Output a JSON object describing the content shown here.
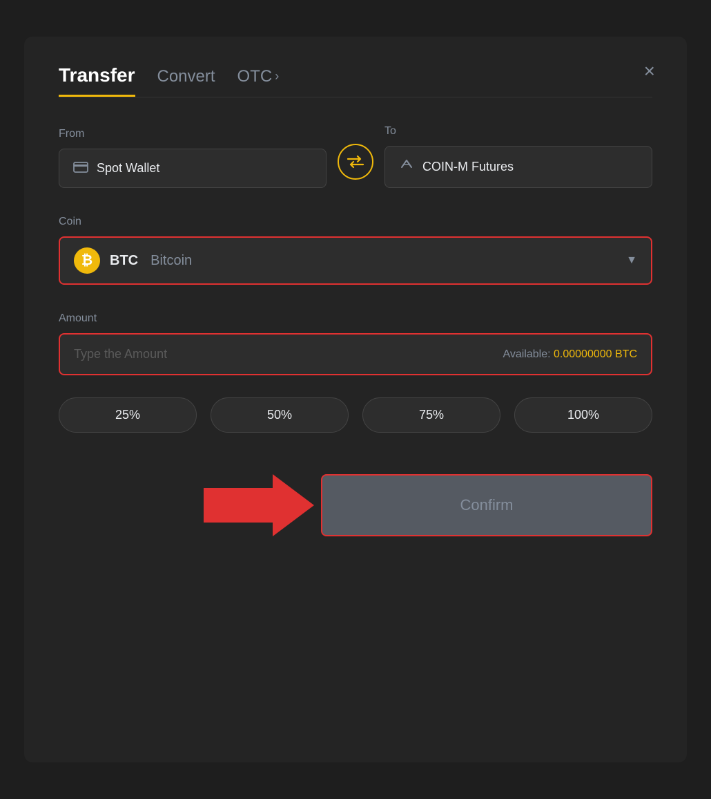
{
  "header": {
    "tab_transfer": "Transfer",
    "tab_convert": "Convert",
    "tab_otc": "OTC",
    "close_label": "×"
  },
  "from": {
    "label": "From",
    "wallet_label": "Spot Wallet",
    "wallet_icon": "🪪"
  },
  "swap": {
    "icon": "⇄"
  },
  "to": {
    "label": "To",
    "wallet_label": "COIN-M Futures",
    "wallet_icon": "↑"
  },
  "coin": {
    "label": "Coin",
    "symbol": "BTC",
    "name": "Bitcoin",
    "icon_letter": "₿"
  },
  "amount": {
    "label": "Amount",
    "placeholder": "Type the Amount",
    "available_label": "Available:",
    "available_value": "0.00000000 BTC"
  },
  "percentages": [
    "25%",
    "50%",
    "75%",
    "100%"
  ],
  "confirm_button": {
    "label": "Confirm"
  }
}
